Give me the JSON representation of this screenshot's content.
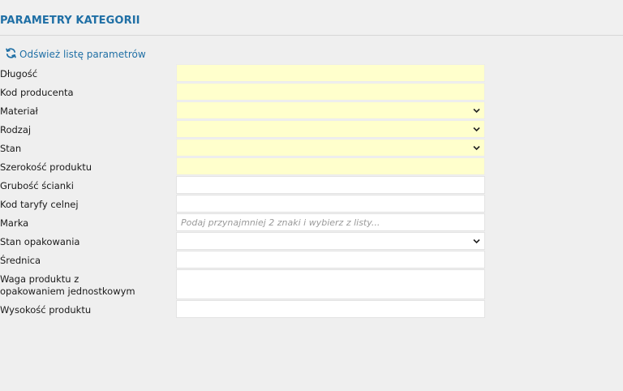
{
  "header": {
    "title": "PARAMETRY KATEGORII"
  },
  "toolbar": {
    "refresh_label": "Odśwież listę parametrów"
  },
  "colors": {
    "accent": "#1f6fa5",
    "required_bg": "#ffffcc",
    "field_bg": "#ffffff"
  },
  "fields": [
    {
      "label": "Długość",
      "type": "text",
      "required": true,
      "value": "",
      "placeholder": ""
    },
    {
      "label": "Kod producenta",
      "type": "text",
      "required": true,
      "value": "",
      "placeholder": ""
    },
    {
      "label": "Materiał",
      "type": "select",
      "required": true,
      "value": ""
    },
    {
      "label": "Rodzaj",
      "type": "select",
      "required": true,
      "value": ""
    },
    {
      "label": "Stan",
      "type": "select",
      "required": true,
      "value": ""
    },
    {
      "label": "Szerokość produktu",
      "type": "text",
      "required": true,
      "value": "",
      "placeholder": ""
    },
    {
      "label": "Grubość ścianki",
      "type": "text",
      "required": false,
      "value": "",
      "placeholder": ""
    },
    {
      "label": "Kod taryfy celnej",
      "type": "text",
      "required": false,
      "value": "",
      "placeholder": ""
    },
    {
      "label": "Marka",
      "type": "text",
      "required": false,
      "value": "",
      "placeholder": "Podaj przynajmniej 2 znaki i wybierz z listy..."
    },
    {
      "label": "Stan opakowania",
      "type": "select",
      "required": false,
      "value": ""
    },
    {
      "label": "Średnica",
      "type": "text",
      "required": false,
      "value": "",
      "placeholder": ""
    },
    {
      "label": "Waga produktu z opakowaniem jednostkowym",
      "type": "text",
      "required": false,
      "value": "",
      "placeholder": ""
    },
    {
      "label": "Wysokość produktu",
      "type": "text",
      "required": false,
      "value": "",
      "placeholder": ""
    }
  ]
}
